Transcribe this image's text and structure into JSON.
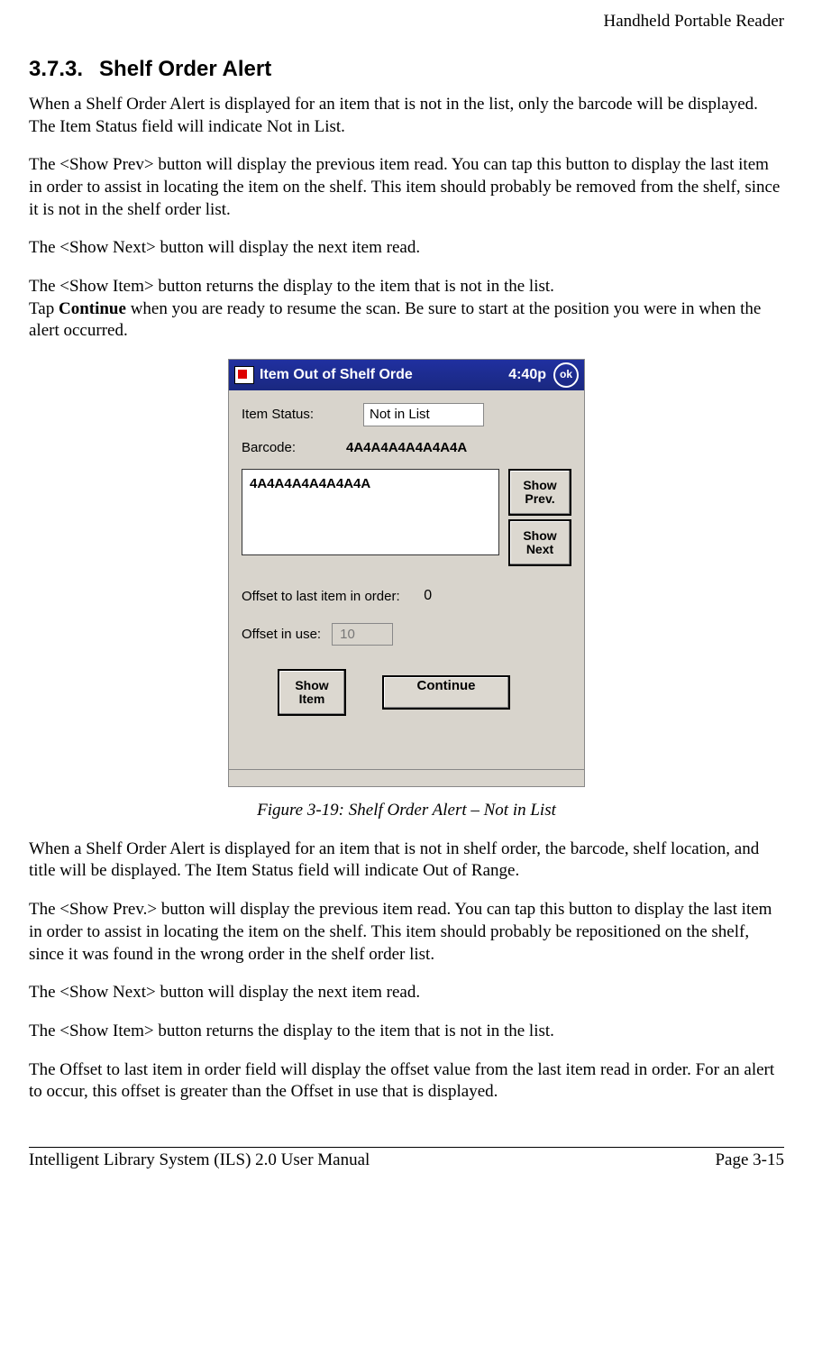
{
  "header": {
    "right": "Handheld Portable Reader"
  },
  "section": {
    "number": "3.7.3.",
    "title": "Shelf Order Alert"
  },
  "para1": "When a Shelf Order Alert is displayed for an item that is not in the list, only the barcode will be displayed. The Item Status field will indicate Not in List.",
  "para2": "The <Show Prev> button will display the previous item read. You can tap this button to display the last item in order to assist in locating the item on the shelf. This item should probably be removed from the shelf, since it is not in the shelf order list.",
  "para3": "The <Show Next> button will display the next item read.",
  "para4a": "The <Show Item> button returns the display to the item that is not in the list.",
  "para4b_pre": "Tap ",
  "para4b_bold": "Continue",
  "para4b_post": " when you are ready to resume the scan. Be sure to start at the position you were in when the alert occurred.",
  "device": {
    "title": "Item Out of Shelf Orde",
    "clock": "4:40p",
    "ok": "ok",
    "item_status_label": "Item Status:",
    "item_status_value": "Not in List",
    "barcode_label": "Barcode:",
    "barcode_value": "4A4A4A4A4A4A4A",
    "bigbox_value": "4A4A4A4A4A4A4A",
    "show_prev": "Show Prev.",
    "show_next": "Show Next",
    "offset_label": "Offset to last item in order:",
    "offset_value": "0",
    "offset_inuse_label": "Offset in use:",
    "offset_inuse_value": "10",
    "show_item": "Show Item",
    "continue": "Continue"
  },
  "caption": "Figure 3-19: Shelf Order Alert – Not in List",
  "para5": "When a Shelf Order Alert is displayed for an item that is not in shelf order, the barcode, shelf location, and title will be displayed. The Item Status field will indicate Out of Range.",
  "para6": "The <Show Prev.> button will display the previous item read. You can tap this button to display the last item in order to assist in locating the item on the shelf. This item should probably be repositioned on the shelf, since it was found in the wrong order in the shelf order list.",
  "para7": "The <Show Next> button will display the next item read.",
  "para8": "The <Show Item> button returns the display to the item that is not in the list.",
  "para9": "The Offset to last item in order field will display the offset value from the last item read in order. For an alert to occur, this offset is greater than the Offset in use that is displayed.",
  "footer": {
    "left": "Intelligent Library System (ILS) 2.0 User Manual",
    "right": "Page 3-15"
  }
}
